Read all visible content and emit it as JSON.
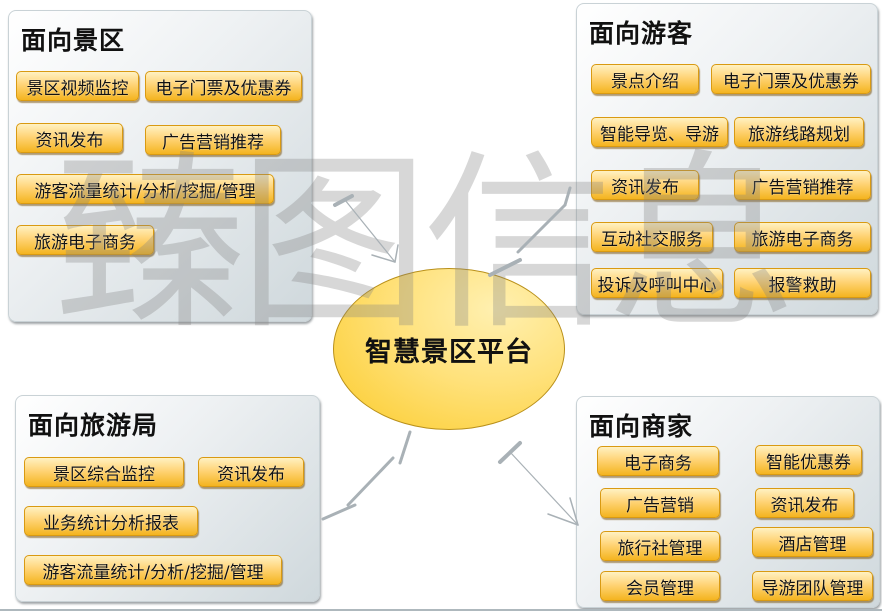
{
  "center": {
    "label": "智慧景区平台"
  },
  "watermark": {
    "text": "臻图信息"
  },
  "panels": {
    "scenic": {
      "title": "面向景区",
      "items": [
        "景区视频监控",
        "电子门票及优惠券",
        "资讯发布",
        "广告营销推荐",
        "游客流量统计/分析/挖掘/管理",
        "旅游电子商务"
      ]
    },
    "tourist": {
      "title": "面向游客",
      "items": [
        "景点介绍",
        "电子门票及优惠券",
        "智能导览、导游",
        "旅游线路规划",
        "资讯发布",
        "广告营销推荐",
        "互动社交服务",
        "旅游电子商务",
        "投诉及呼叫中心",
        "报警救助"
      ]
    },
    "bureau": {
      "title": "面向旅游局",
      "items": [
        "景区综合监控",
        "资讯发布",
        "业务统计分析报表",
        "游客流量统计/分析/挖掘/管理"
      ]
    },
    "merchant": {
      "title": "面向商家",
      "items": [
        "电子商务",
        "智能优惠券",
        "广告营销",
        "资讯发布",
        "旅行社管理",
        "酒店管理",
        "会员管理",
        "导游团队管理"
      ]
    }
  },
  "colors": {
    "button_top": "#fff1c2",
    "button_bottom": "#f4b41f",
    "center_fill": "#ffe17a",
    "panel_edge": "#cfd8dc"
  }
}
